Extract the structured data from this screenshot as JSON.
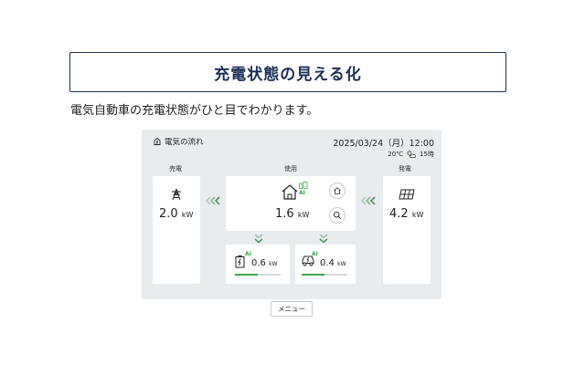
{
  "page": {
    "title": "充電状態の見える化",
    "description": "電気自動車の充電状態がひと目でわかります。"
  },
  "panel": {
    "header_title": "電気の流れ",
    "datetime": "2025/03/24（月）12:00",
    "temperature": "20℃",
    "weather_time": "15時",
    "sections": {
      "generation": "売電",
      "usage": "使用",
      "solar": "発電"
    },
    "grid": {
      "value": "2.0",
      "unit": "kW",
      "icon": "power-tower-icon"
    },
    "home": {
      "value": "1.6",
      "unit": "kW",
      "icon": "house-icon",
      "badge": "AI"
    },
    "solar": {
      "value": "4.2",
      "unit": "kW",
      "icon": "solar-panel-icon"
    },
    "battery": {
      "value": "0.6",
      "unit": "kW",
      "badge": "AI",
      "level": 0.5
    },
    "ev": {
      "value": "0.4",
      "unit": "kW",
      "badge": "AI",
      "level": 0.5
    },
    "menu_label": "メニュー"
  },
  "colors": {
    "title_border": "#1d2e55",
    "accent_green": "#3aa84d",
    "panel_bg": "#e9ecef"
  }
}
